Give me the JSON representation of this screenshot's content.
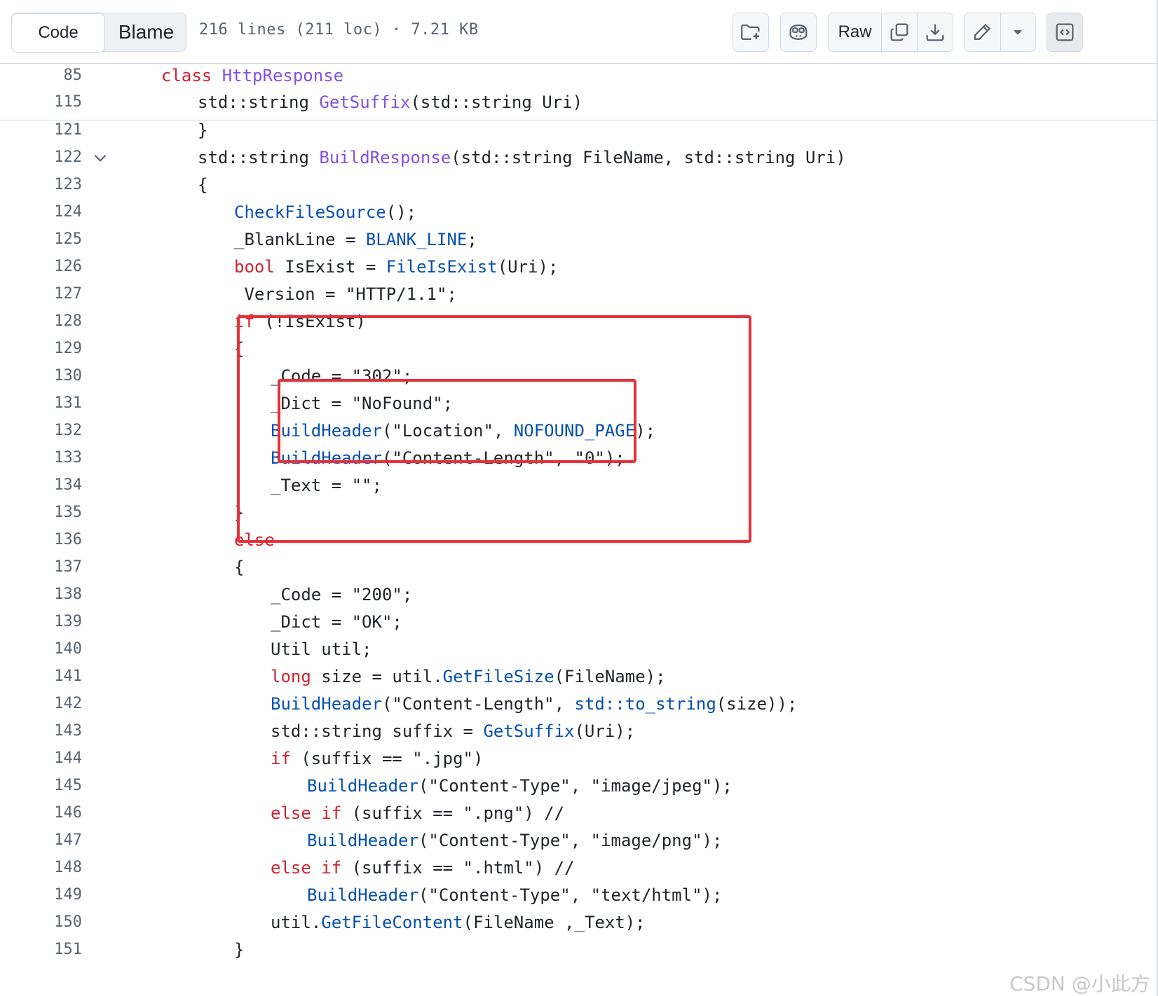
{
  "toolbar": {
    "tabs": [
      {
        "label": "Code",
        "selected": true
      },
      {
        "label": "Blame",
        "selected": false
      }
    ],
    "file_info": "216 lines (211 loc) · 7.21 KB",
    "raw_label": "Raw",
    "icons": [
      "file-tree-icon",
      "copilot-icon",
      "copy-icon",
      "download-icon",
      "pencil-icon",
      "dropdown-caret-icon",
      "symbols-panel-icon"
    ]
  },
  "sticky_lines": [
    {
      "num": "85",
      "tokens": [
        {
          "t": "class",
          "c": "kw"
        },
        {
          "t": " ",
          "c": ""
        },
        {
          "t": "HttpResponse",
          "c": "tn"
        }
      ],
      "indent": 0
    },
    {
      "num": "115",
      "tokens": [
        {
          "t": "std::string ",
          "c": ""
        },
        {
          "t": "GetSuffix",
          "c": "tn"
        },
        {
          "t": "(std::string Uri)",
          "c": ""
        }
      ],
      "indent": 1
    }
  ],
  "lines": [
    {
      "num": "121",
      "indent": 1,
      "tokens": [
        {
          "t": "}",
          "c": ""
        }
      ]
    },
    {
      "num": "122",
      "indent": 1,
      "fold": true,
      "tokens": [
        {
          "t": "std::string ",
          "c": ""
        },
        {
          "t": "BuildResponse",
          "c": "tn"
        },
        {
          "t": "(std::string FileName, std::string Uri)",
          "c": ""
        }
      ]
    },
    {
      "num": "123",
      "indent": 1,
      "tokens": [
        {
          "t": "{",
          "c": ""
        }
      ]
    },
    {
      "num": "124",
      "indent": 2,
      "tokens": [
        {
          "t": "CheckFileSource",
          "c": "fn"
        },
        {
          "t": "();",
          "c": ""
        }
      ]
    },
    {
      "num": "125",
      "indent": 2,
      "tokens": [
        {
          "t": "_BlankLine = ",
          "c": ""
        },
        {
          "t": "BLANK_LINE",
          "c": "fn"
        },
        {
          "t": ";",
          "c": ""
        }
      ]
    },
    {
      "num": "126",
      "indent": 2,
      "tokens": [
        {
          "t": "bool",
          "c": "kw"
        },
        {
          "t": " IsExist = ",
          "c": ""
        },
        {
          "t": "FileIsExist",
          "c": "fn"
        },
        {
          "t": "(Uri);",
          "c": ""
        }
      ]
    },
    {
      "num": "127",
      "indent": 2,
      "tokens": [
        {
          "t": " Version = \"HTTP/1.1\";",
          "c": ""
        }
      ]
    },
    {
      "num": "128",
      "indent": 2,
      "tokens": [
        {
          "t": "if",
          "c": "kw"
        },
        {
          "t": " (!IsExist)",
          "c": ""
        }
      ]
    },
    {
      "num": "129",
      "indent": 2,
      "tokens": [
        {
          "t": "{",
          "c": ""
        }
      ]
    },
    {
      "num": "130",
      "indent": 3,
      "tokens": [
        {
          "t": "_Code = \"302\";",
          "c": ""
        }
      ]
    },
    {
      "num": "131",
      "indent": 3,
      "tokens": [
        {
          "t": "_Dict = \"NoFound\";",
          "c": ""
        }
      ]
    },
    {
      "num": "132",
      "indent": 3,
      "tokens": [
        {
          "t": "BuildHeader",
          "c": "fn"
        },
        {
          "t": "(\"Location\", ",
          "c": ""
        },
        {
          "t": "NOFOUND_PAGE",
          "c": "fn"
        },
        {
          "t": ");",
          "c": ""
        }
      ]
    },
    {
      "num": "133",
      "indent": 3,
      "tokens": [
        {
          "t": "BuildHeader",
          "c": "fn"
        },
        {
          "t": "(\"Content-Length\", \"0\");",
          "c": ""
        }
      ]
    },
    {
      "num": "134",
      "indent": 3,
      "tokens": [
        {
          "t": "_Text = \"\";",
          "c": ""
        }
      ]
    },
    {
      "num": "135",
      "indent": 2,
      "tokens": [
        {
          "t": "}",
          "c": ""
        }
      ]
    },
    {
      "num": "136",
      "indent": 2,
      "tokens": [
        {
          "t": "else",
          "c": "kw"
        }
      ]
    },
    {
      "num": "137",
      "indent": 2,
      "tokens": [
        {
          "t": "{",
          "c": ""
        }
      ]
    },
    {
      "num": "138",
      "indent": 3,
      "tokens": [
        {
          "t": "_Code = \"200\";",
          "c": ""
        }
      ]
    },
    {
      "num": "139",
      "indent": 3,
      "tokens": [
        {
          "t": "_Dict = \"OK\";",
          "c": ""
        }
      ]
    },
    {
      "num": "140",
      "indent": 3,
      "tokens": [
        {
          "t": "Util util;",
          "c": ""
        }
      ]
    },
    {
      "num": "141",
      "indent": 3,
      "tokens": [
        {
          "t": "long",
          "c": "kw"
        },
        {
          "t": " size = util.",
          "c": ""
        },
        {
          "t": "GetFileSize",
          "c": "fn"
        },
        {
          "t": "(FileName);",
          "c": ""
        }
      ]
    },
    {
      "num": "142",
      "indent": 3,
      "tokens": [
        {
          "t": "BuildHeader",
          "c": "fn"
        },
        {
          "t": "(\"Content-Length\", ",
          "c": ""
        },
        {
          "t": "std::to_string",
          "c": "fn"
        },
        {
          "t": "(size));",
          "c": ""
        }
      ]
    },
    {
      "num": "143",
      "indent": 3,
      "tokens": [
        {
          "t": "std::string suffix = ",
          "c": ""
        },
        {
          "t": "GetSuffix",
          "c": "fn"
        },
        {
          "t": "(Uri);",
          "c": ""
        }
      ]
    },
    {
      "num": "144",
      "indent": 3,
      "tokens": [
        {
          "t": "if",
          "c": "kw"
        },
        {
          "t": " (suffix == \".jpg\")",
          "c": ""
        }
      ]
    },
    {
      "num": "145",
      "indent": 4,
      "tokens": [
        {
          "t": "BuildHeader",
          "c": "fn"
        },
        {
          "t": "(\"Content-Type\", \"image/jpeg\");",
          "c": ""
        }
      ]
    },
    {
      "num": "146",
      "indent": 3,
      "tokens": [
        {
          "t": "else",
          "c": "kw"
        },
        {
          "t": " ",
          "c": ""
        },
        {
          "t": "if",
          "c": "kw"
        },
        {
          "t": " (suffix == \".png\") //",
          "c": ""
        }
      ]
    },
    {
      "num": "147",
      "indent": 4,
      "tokens": [
        {
          "t": "BuildHeader",
          "c": "fn"
        },
        {
          "t": "(\"Content-Type\", \"image/png\");",
          "c": ""
        }
      ]
    },
    {
      "num": "148",
      "indent": 3,
      "tokens": [
        {
          "t": "else",
          "c": "kw"
        },
        {
          "t": " ",
          "c": ""
        },
        {
          "t": "if",
          "c": "kw"
        },
        {
          "t": " (suffix == \".html\") //",
          "c": ""
        }
      ]
    },
    {
      "num": "149",
      "indent": 4,
      "tokens": [
        {
          "t": "BuildHeader",
          "c": "fn"
        },
        {
          "t": "(\"Content-Type\", \"text/html\");",
          "c": ""
        }
      ]
    },
    {
      "num": "150",
      "indent": 3,
      "tokens": [
        {
          "t": "util.",
          "c": ""
        },
        {
          "t": "GetFileContent",
          "c": "fn"
        },
        {
          "t": "(FileName ,_Text);",
          "c": ""
        }
      ]
    },
    {
      "num": "151",
      "indent": 2,
      "tokens": [
        {
          "t": "}",
          "c": ""
        }
      ]
    }
  ],
  "watermark": "CSDN @小此方",
  "colors": {
    "keyword": "#cf222e",
    "function": "#0550ae",
    "type": "#8250df",
    "highlight_box": "#e5323b",
    "line_number": "#59636e"
  }
}
